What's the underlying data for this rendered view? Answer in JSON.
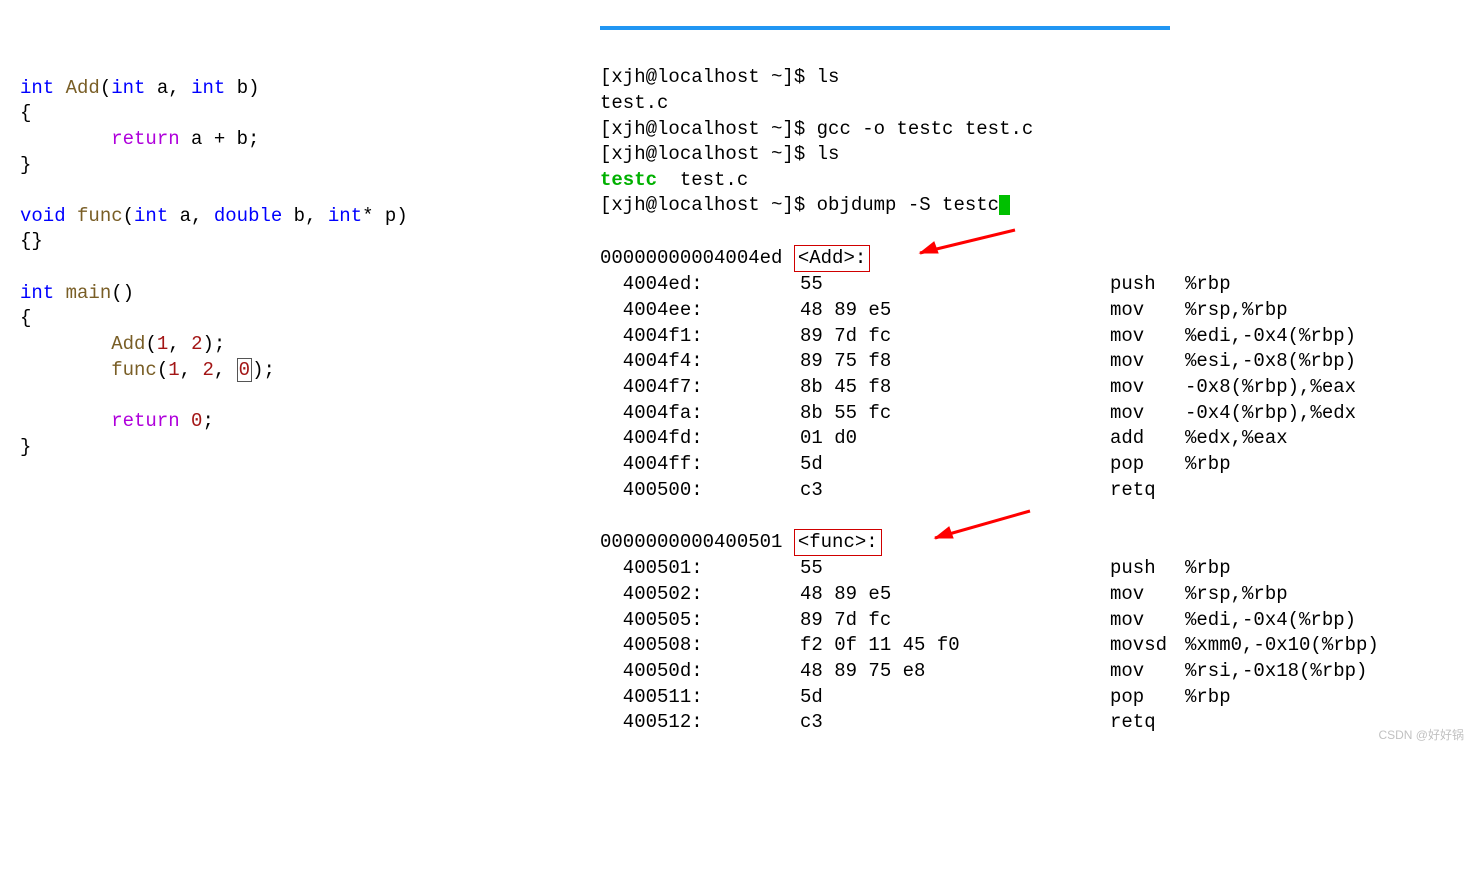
{
  "source": {
    "l1": {
      "kw1": "int",
      "fn": "Add",
      "p": "(",
      "kw2": "int",
      "a": " a, ",
      "kw3": "int",
      "b": " b)"
    },
    "l2": "{",
    "l3": {
      "indent": "        ",
      "ret": "return",
      "expr": " a + b;"
    },
    "l4": "}",
    "blank1": "",
    "l5": {
      "kw1": "void",
      "fn": " func",
      "p": "(",
      "kw2": "int",
      "a": " a, ",
      "kw3": "double",
      "b": " b, ",
      "kw4": "int",
      "ptr": "* p)"
    },
    "l6": "{}",
    "blank2": "",
    "l7": {
      "kw1": "int",
      "fn": " main",
      "p": "()"
    },
    "l8": "{",
    "l9": {
      "indent": "        ",
      "fn": "Add",
      "open": "(",
      "n1": "1",
      "c": ", ",
      "n2": "2",
      "close": ");"
    },
    "l10": {
      "indent": "        ",
      "fn": "func",
      "open": "(",
      "n1": "1",
      "c1": ", ",
      "n2": "2",
      "c2": ", ",
      "n3": "0",
      "close": ");"
    },
    "blank3": "",
    "l11": {
      "indent": "        ",
      "ret": "return",
      "sp": " ",
      "n": "0",
      "semi": ";"
    },
    "l12": "}"
  },
  "term": {
    "p1": "[xjh@localhost ~]$ ",
    "c1": "ls",
    "o1": "test.c",
    "p2": "[xjh@localhost ~]$ ",
    "c2": "gcc -o testc test.c",
    "p3": "[xjh@localhost ~]$ ",
    "c3": "ls",
    "o2a": "testc",
    "o2b": "  test.c",
    "p4": "[xjh@localhost ~]$ ",
    "c4": "objdump -S testc"
  },
  "asm": {
    "h1_addr": "00000000004004ed ",
    "h1_label": "<Add>:",
    "rows1": [
      {
        "addr": "  4004ed:",
        "hex": "55",
        "mnem": "push",
        "op": "%rbp"
      },
      {
        "addr": "  4004ee:",
        "hex": "48 89 e5",
        "mnem": "mov",
        "op": "%rsp,%rbp"
      },
      {
        "addr": "  4004f1:",
        "hex": "89 7d fc",
        "mnem": "mov",
        "op": "%edi,-0x4(%rbp)"
      },
      {
        "addr": "  4004f4:",
        "hex": "89 75 f8",
        "mnem": "mov",
        "op": "%esi,-0x8(%rbp)"
      },
      {
        "addr": "  4004f7:",
        "hex": "8b 45 f8",
        "mnem": "mov",
        "op": "-0x8(%rbp),%eax"
      },
      {
        "addr": "  4004fa:",
        "hex": "8b 55 fc",
        "mnem": "mov",
        "op": "-0x4(%rbp),%edx"
      },
      {
        "addr": "  4004fd:",
        "hex": "01 d0",
        "mnem": "add",
        "op": "%edx,%eax"
      },
      {
        "addr": "  4004ff:",
        "hex": "5d",
        "mnem": "pop",
        "op": "%rbp"
      },
      {
        "addr": "  400500:",
        "hex": "c3",
        "mnem": "retq",
        "op": ""
      }
    ],
    "h2_addr": "0000000000400501 ",
    "h2_label": "<func>:",
    "rows2": [
      {
        "addr": "  400501:",
        "hex": "55",
        "mnem": "push",
        "op": "%rbp"
      },
      {
        "addr": "  400502:",
        "hex": "48 89 e5",
        "mnem": "mov",
        "op": "%rsp,%rbp"
      },
      {
        "addr": "  400505:",
        "hex": "89 7d fc",
        "mnem": "mov",
        "op": "%edi,-0x4(%rbp)"
      },
      {
        "addr": "  400508:",
        "hex": "f2 0f 11 45 f0",
        "mnem": "movsd",
        "op": "%xmm0,-0x10(%rbp)"
      },
      {
        "addr": "  40050d:",
        "hex": "48 89 75 e8",
        "mnem": "mov",
        "op": "%rsi,-0x18(%rbp)"
      },
      {
        "addr": "  400511:",
        "hex": "5d",
        "mnem": "pop",
        "op": "%rbp"
      },
      {
        "addr": "  400512:",
        "hex": "c3",
        "mnem": "retq",
        "op": ""
      }
    ]
  },
  "watermark": "CSDN @好好锅"
}
